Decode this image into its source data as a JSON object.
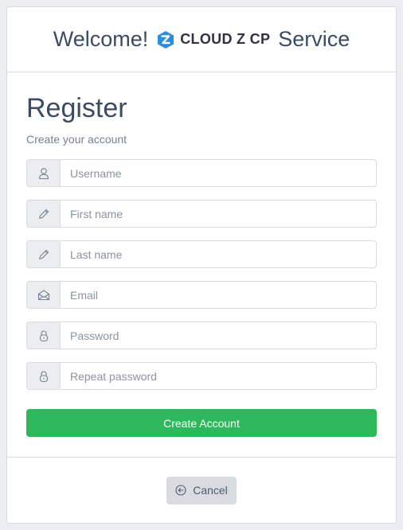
{
  "header": {
    "welcome": "Welcome!",
    "brand": "CLOUD Z CP",
    "service": "Service",
    "logo_icon": "z-hexagon-logo",
    "logo_color": "#2a8de0"
  },
  "form": {
    "title": "Register",
    "subtitle": "Create your account",
    "fields": [
      {
        "icon": "user-icon",
        "placeholder": "Username",
        "value": ""
      },
      {
        "icon": "pencil-icon",
        "placeholder": "First name",
        "value": ""
      },
      {
        "icon": "pencil-icon",
        "placeholder": "Last name",
        "value": ""
      },
      {
        "icon": "envelope-icon",
        "placeholder": "Email",
        "value": ""
      },
      {
        "icon": "lock-icon",
        "placeholder": "Password",
        "value": ""
      },
      {
        "icon": "lock-icon",
        "placeholder": "Repeat password",
        "value": ""
      }
    ],
    "submit_label": "Create Account",
    "submit_color": "#2eb85c"
  },
  "footer": {
    "cancel_label": "Cancel",
    "cancel_icon": "arrow-circle-left-icon"
  }
}
